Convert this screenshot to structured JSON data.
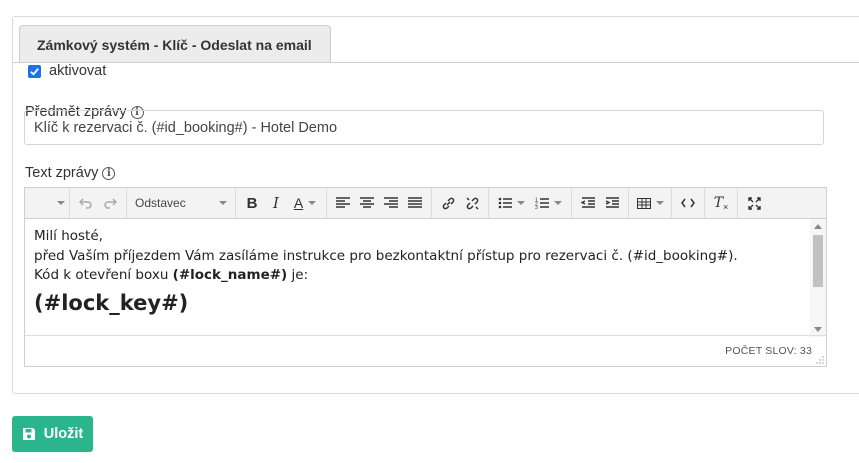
{
  "tab": {
    "label": "Zámkový systém - Klíč - Odeslat na email"
  },
  "activate": {
    "label": "aktivovat",
    "checked": true
  },
  "subject": {
    "label": "Předmět zprávy",
    "value": "Klíč k rezervaci č. (#id_booking#) - Hotel Demo"
  },
  "message": {
    "label": "Text zprávy"
  },
  "toolbar": {
    "format_select": "Odstavec"
  },
  "editor": {
    "line1": "Milí hosté,",
    "line2": "před Vaším příjezdem Vám zasíláme instrukce pro bezkontaktní přístup pro rezervaci č. (#id_booking#).",
    "line3_prefix": "Kód k otevření boxu ",
    "line3_bold": "(#lock_name#)",
    "line3_suffix": " je:",
    "key_heading": "(#lock_key#)"
  },
  "statusbar": {
    "word_count": "POČET SLOV: 33"
  },
  "save_button": {
    "label": "Uložit"
  },
  "colors": {
    "accent": "#2bb58c",
    "checkbox": "#1a73e8"
  }
}
